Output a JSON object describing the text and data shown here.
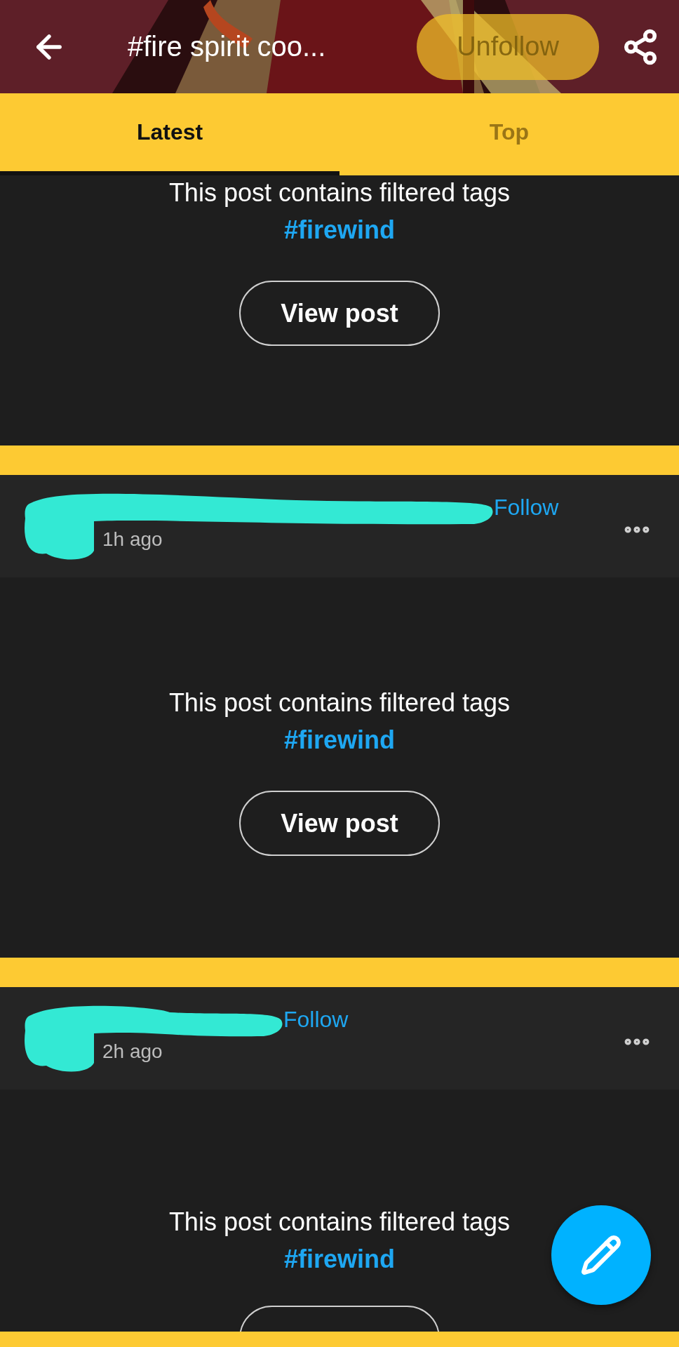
{
  "header": {
    "title": "#fire spirit coo...",
    "unfollow_label": "Unfollow"
  },
  "tabs": [
    {
      "label": "Latest",
      "selected": true
    },
    {
      "label": "Top",
      "selected": false
    }
  ],
  "posts": [
    {
      "kind": "cut_top",
      "notice": "This post contains filtered tags",
      "tag": "#firewind",
      "button": "View post"
    },
    {
      "kind": "full",
      "time": "1h ago",
      "follow": "Follow",
      "notice": "This post contains filtered tags",
      "tag": "#firewind",
      "button": "View post"
    },
    {
      "kind": "cut_bottom",
      "time": "2h ago",
      "follow": "Follow",
      "notice": "This post contains filtered tags",
      "tag": "#firewind"
    }
  ]
}
